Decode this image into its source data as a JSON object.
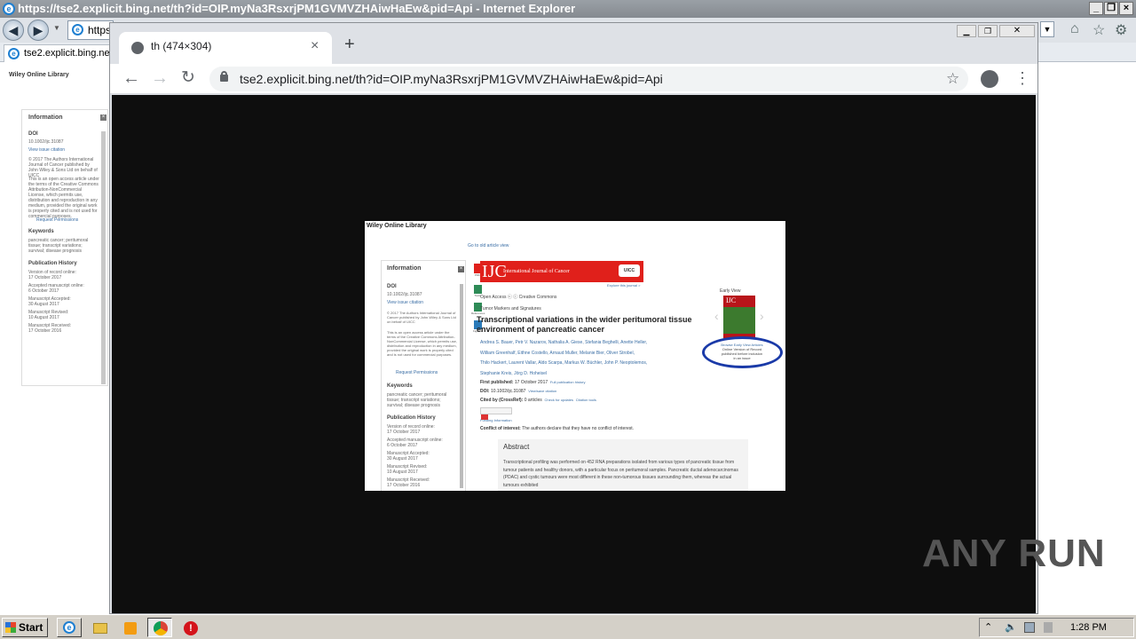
{
  "ie": {
    "title": "https://tse2.explicit.bing.net/th?id=OIP.myNa3RsxrjPM1GVMVZHAiwHaEw&pid=Api - Internet Explorer",
    "address": "https",
    "tab_label": "tse2.explicit.bing.net",
    "page": {
      "library": "Wiley Online Library",
      "info_heading": "Information",
      "doi_label": "DOI",
      "doi": "10.1002/ijc.31087",
      "view_citation": "View issue citation",
      "copyright": "© 2017 The Authors International Journal of Cancer published by John Wiley & Sons Ltd on behalf of UICC",
      "license": "This is an open access article under the terms of the Creative Commons Attribution-NonCommercial License, which permits use, distribution and reproduction in any medium, provided the original work is properly cited and is not used for commercial purposes.",
      "request_permissions": "Request Permissions",
      "keywords_heading": "Keywords",
      "keywords": "pancreatic cancer; peritumoral tissue; transcript variations; survival; disease prognosis",
      "history_heading": "Publication History",
      "history": [
        [
          "Version of record online:",
          "17 October 2017"
        ],
        [
          "Accepted manuscript online:",
          "6 October 2017"
        ],
        [
          "Manuscript Accepted:",
          "30 August 2017"
        ],
        [
          "Manuscript Revised:",
          "10 August 2017"
        ],
        [
          "Manuscript Received:",
          "17 October 2016"
        ]
      ]
    }
  },
  "chrome": {
    "tab_title": "th (474×304)",
    "url": "tse2.explicit.bing.net/th?id=OIP.myNa3RsxrjPM1GVMVZHAiwHaEw&pid=Api",
    "new_tab_symbol": "+",
    "close_symbol": "×"
  },
  "image": {
    "library": "Wiley Online Library",
    "go_old": "Go to old article view",
    "journal": "International Journal of Cancer",
    "journal_short": "IJC",
    "uicc": "UICC",
    "explore": "Explore this journal >",
    "open_access": "Open Access",
    "creative_commons": "Creative Commons",
    "section": "Tumor Markers and Signatures",
    "title_line1": "Transcriptional variations in the wider peritumoral tissue",
    "title_line2": "environment of pancreatic cancer",
    "authors1": "Andrea S. Bauer, Petr V. Nazarov, Nathalia A. Giese, Stefania Beghelli, Anette Heller,",
    "authors2": "William Greenhalf, Eithne Costello, Arnaud Muller, Melanie Bier, Oliver Strobel,",
    "authors3": "Thilo Hackert, Laurent Vallar, Aldo Scarpa, Markus W. Büchler, John P. Neoptolemos,",
    "authors4": "Stephanie Kreis, Jörg D. Hoheisel",
    "first_pub_label": "First published:",
    "first_pub": "17 October 2017",
    "full_history": "Full publication history",
    "doi_label": "DOI:",
    "doi": "10.1002/ijc.31087",
    "view_citation": "View/save citation",
    "cited_label": "Cited by (CrossRef):",
    "cited": "0 articles",
    "check_updates": "Check for updates",
    "citation_tools": "Citation tools",
    "funding": "Funding Information",
    "conflict_label": "Conflict of interest:",
    "conflict": "The authors declare that they have no conflict of interest.",
    "abstract_heading": "Abstract",
    "abstract": "Transcriptional profiling was performed on 452 RNA preparations isolated from various types of pancreatic tissue from tumour patients and healthy donors, with a particular focus on peritumoral samples. Pancreatic ductal adenocarcinomas (PDAC) and cystic tumours were most different in these non-tumorous tissues surrounding them, whereas the actual tumours exhibited",
    "early_view": "Early View",
    "browse_early": "Browse Early View Articles",
    "online_version": "Online Version of Record",
    "published_before": "published before inclusion",
    "in_issue": "in an issue",
    "side_pdf": "PDF",
    "side_tools": "Tools",
    "side_share": "Share",
    "side_references": "References",
    "side_figures": "Figures",
    "info_heading": "Information",
    "info_doi_label": "DOI",
    "info_doi": "10.1002/ijc.31087",
    "info_view_citation": "View issue citation",
    "info_copyright": "© 2017 The Authors International Journal of Cancer published by John Wiley & Sons Ltd on behalf of UICC",
    "info_license": "This is an open access article under the terms of the Creative Commons Attribution-NonCommercial License, which permits use, distribution and reproduction in any medium, provided the original work is properly cited and is not used for commercial purposes.",
    "info_request": "Request Permissions",
    "info_keywords_heading": "Keywords",
    "info_keywords": "pancreatic cancer; peritumoral tissue; transcript variations; survival; disease prognosis",
    "info_history_heading": "Publication History",
    "info_history": [
      [
        "Version of record online:",
        "17 October 2017"
      ],
      [
        "Accepted manuscript online:",
        "6 October 2017"
      ],
      [
        "Manuscript Accepted:",
        "30 August 2017"
      ],
      [
        "Manuscript Revised:",
        "10 August 2017"
      ],
      [
        "Manuscript Received:",
        "17 October 2016"
      ]
    ]
  },
  "watermark": "ANY RUN",
  "taskbar": {
    "start": "Start",
    "clock": "1:28 PM"
  },
  "colors": {
    "ie_title": "#8f949a",
    "chrome_frame": "#dee1e6",
    "viewer_bg": "#0e0e0e",
    "ijc_red": "#e0201b",
    "highlight_circle": "#1a3aa8"
  }
}
